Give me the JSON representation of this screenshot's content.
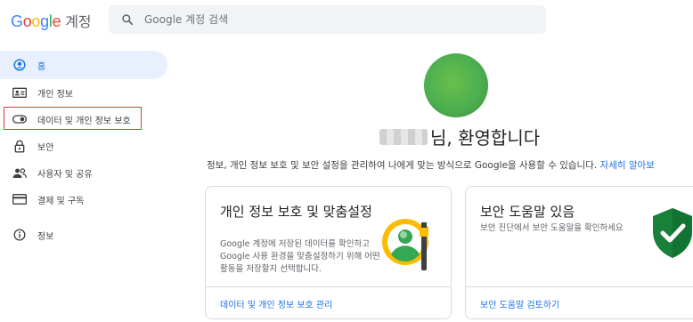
{
  "header": {
    "logo_letters": [
      "G",
      "o",
      "o",
      "g",
      "l",
      "e"
    ],
    "logo_suffix": "계정",
    "search_placeholder": "Google 계정 검색"
  },
  "sidebar": {
    "items": [
      {
        "label": "홈",
        "icon": "home-icon"
      },
      {
        "label": "개인 정보",
        "icon": "id-card-icon"
      },
      {
        "label": "데이터 및 개인 정보 보호",
        "icon": "toggle-icon"
      },
      {
        "label": "보안",
        "icon": "lock-icon"
      },
      {
        "label": "사용자 및 공유",
        "icon": "people-icon"
      },
      {
        "label": "결제 및 구독",
        "icon": "credit-card-icon"
      },
      {
        "label": "정보",
        "icon": "info-icon"
      }
    ]
  },
  "main": {
    "greeting_suffix": "님, 환영합니다",
    "description": "정보, 개인 정보 보호 및 보안 설정을 관리하여 나에게 맞는 방식으로 Google을 사용할 수 있습니다.",
    "description_link": "자세히 알아보",
    "cards": [
      {
        "title": "개인 정보 보호 및 맞춤설정",
        "body": "Google 계정에 저장된 데이터를 확인하고 Google 사용 환경을 맞춤설정하기 위해 어떤 활동을 저장할지 선택합니다.",
        "link": "데이터 및 개인 정보 보호 관리"
      },
      {
        "title": "보안 도움말 있음",
        "body": "보안 진단에서 보안 도움말을 확인하세요",
        "link": "보안 도움말 검토하기"
      }
    ]
  },
  "colors": {
    "accent": "#1a73e8",
    "active_bg": "#e8f0fe",
    "highlight_border": "#e53935",
    "shield": "#188038"
  }
}
